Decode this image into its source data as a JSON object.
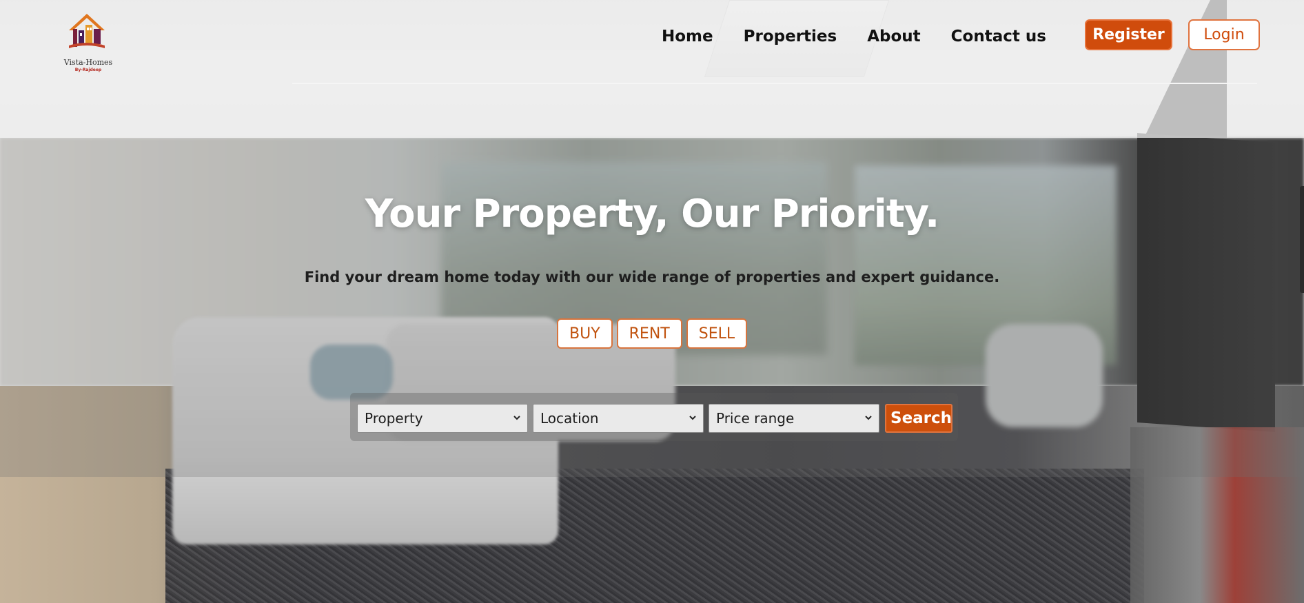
{
  "brand": {
    "name": "Vista-Homes",
    "tagline": "By-Rajdeep"
  },
  "nav": {
    "items": [
      "Home",
      "Properties",
      "About",
      "Contact us"
    ],
    "register_label": "Register",
    "login_label": "Login"
  },
  "hero": {
    "title": "Your Property, Our Priority.",
    "subtitle": "Find your dream home today with our wide range of properties and expert guidance.",
    "modes": [
      "BUY",
      "RENT",
      "SELL"
    ]
  },
  "search": {
    "property_select": "Property",
    "location_select": "Location",
    "price_select": "Price range",
    "button_label": "Search"
  },
  "colors": {
    "accent": "#d04c0c",
    "header_bg": "#f0f0f0",
    "text_dark": "#111111"
  }
}
